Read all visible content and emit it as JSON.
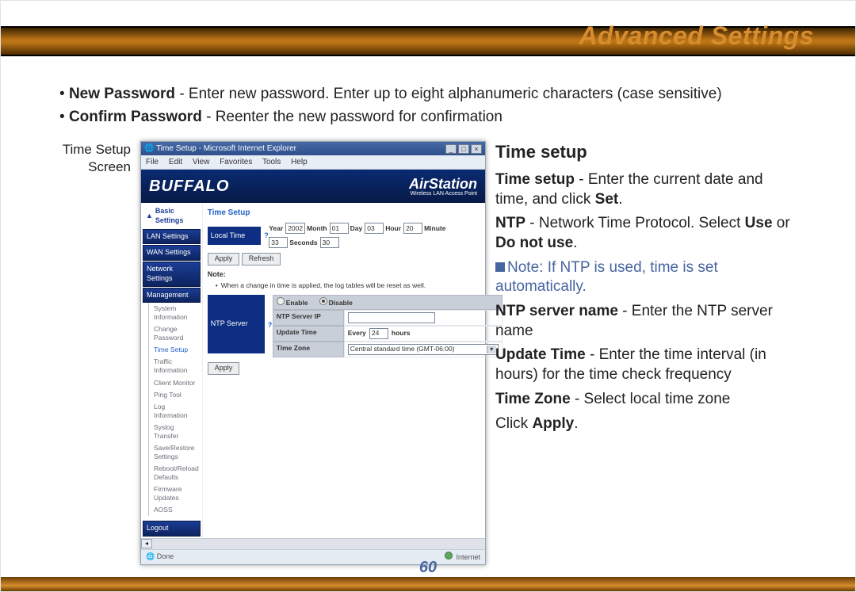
{
  "page": {
    "title": "Advanced Settings",
    "number": "60"
  },
  "bullets": {
    "np_bold": "New Password",
    "np_rest": " - Enter new password.  Enter up to eight alphanumeric characters (case sensitive)",
    "cp_bold": "Confirm Password",
    "cp_rest": " - Reenter the new password for confirmation"
  },
  "caption": {
    "line1": "Time Setup",
    "line2": "Screen"
  },
  "ie": {
    "title": "Time Setup - Microsoft Internet Explorer",
    "min": "_",
    "max": "□",
    "close": "×",
    "menus": {
      "file": "File",
      "edit": "Edit",
      "view": "View",
      "fav": "Favorites",
      "tools": "Tools",
      "help": "Help"
    },
    "status_left": "Done",
    "status_right": "Internet"
  },
  "brand": {
    "buffalo": "BUFFALO",
    "air": "AirStation",
    "sub": "Wireless LAN Access Point"
  },
  "sidebar": {
    "basic": "Basic Settings",
    "lan": "LAN Settings",
    "wan": "WAN Settings",
    "net": "Network Settings",
    "mgmt": "Management",
    "subs": [
      "System Information",
      "Change Password",
      "Time Setup",
      "Traffic Information",
      "Client Monitor",
      "Ping Tool",
      "Log Information",
      "Syslog Transfer",
      "Save/Restore Settings",
      "Reboot/Reload Defaults",
      "Firmware Updates",
      "AOSS"
    ],
    "logout": "Logout"
  },
  "timepane": {
    "heading": "Time Setup",
    "localtime_lbl": "Local Time",
    "help": "?",
    "year_lbl": "Year",
    "year": "2002",
    "month_lbl": "Month",
    "month": "01",
    "day_lbl": "Day",
    "day": "03",
    "hour_lbl": "Hour",
    "hour": "20",
    "minute_lbl": "Minute",
    "minute": "33",
    "seconds_lbl": "Seconds",
    "seconds": "30",
    "apply": "Apply",
    "refresh": "Refresh",
    "note_lbl": "Note:",
    "note_li": "When a change in time is applied, the log tables will be reset as well.",
    "enable": "Enable",
    "disable": "Disable",
    "ntp_server_lbl": "NTP Server",
    "ntp_ip_lbl": "NTP Server IP",
    "update_lbl": "Update Time",
    "every": "Every",
    "update_val": "24",
    "hours": "hours",
    "tz_lbl": "Time Zone",
    "tz_val": "Central standard time (GMT-06:00)"
  },
  "right": {
    "heading": "Time setup",
    "p1b": "Time setup",
    "p1r": " - Enter the current date and time, and click ",
    "p1b2": "Set",
    "p1r2": ".",
    "p2b": "NTP",
    "p2r": " - Network Time Protocol. Select ",
    "p2b2": "Use",
    "p2r2": " or ",
    "p2b3": "Do not use",
    "p2r3": ".",
    "note": "Note: If NTP is used, time is set automatically.",
    "p3b": "NTP server name",
    "p3r": " - Enter the NTP server name",
    "p4b": "Update Time",
    "p4r": " - Enter the time interval (in hours) for the time check frequency",
    "p5b": "Time Zone",
    "p5r": " - Select local time zone",
    "p6a": "Click ",
    "p6b": "Apply",
    "p6c": "."
  }
}
